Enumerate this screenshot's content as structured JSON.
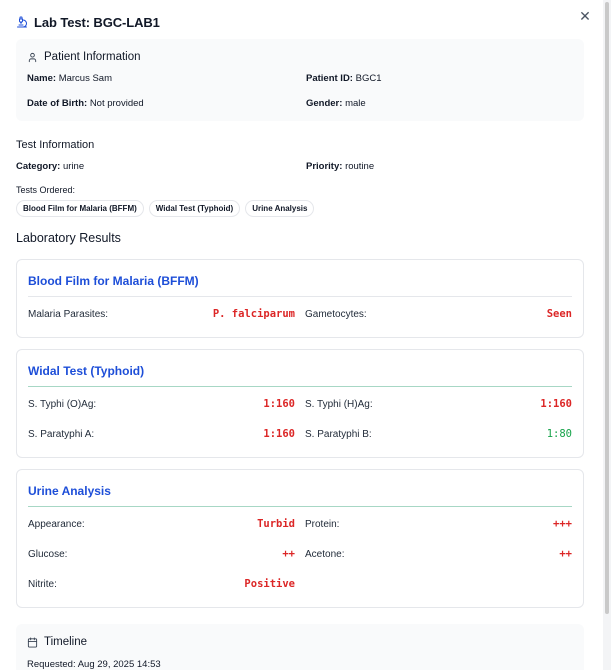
{
  "header": {
    "title": "Lab Test: BGC-LAB1",
    "icon": "microscope-icon",
    "close_icon": "close-icon"
  },
  "patient": {
    "section_title": "Patient Information",
    "name_label": "Name:",
    "name_value": "Marcus Sam",
    "id_label": "Patient ID:",
    "id_value": "BGC1",
    "dob_label": "Date of Birth:",
    "dob_value": "Not provided",
    "gender_label": "Gender:",
    "gender_value": "male"
  },
  "test_info": {
    "section_title": "Test Information",
    "category_label": "Category:",
    "category_value": "urine",
    "priority_label": "Priority:",
    "priority_value": "routine",
    "tests_ordered_label": "Tests Ordered:",
    "tests_ordered": [
      "Blood Film for Malaria (BFFM)",
      "Widal Test (Typhoid)",
      "Urine Analysis"
    ]
  },
  "results": {
    "title": "Laboratory Results",
    "bffm": {
      "title": "Blood Film for Malaria (BFFM)",
      "malaria_label": "Malaria Parasites:",
      "malaria_value": "P. falciparum",
      "gametocytes_label": "Gametocytes:",
      "gametocytes_value": "Seen"
    },
    "widal": {
      "title": "Widal Test (Typhoid)",
      "o_label": "S. Typhi (O)Ag:",
      "o_value": "1:160",
      "h_label": "S. Typhi (H)Ag:",
      "h_value": "1:160",
      "pa_label": "S. Paratyphi A:",
      "pa_value": "1:160",
      "pb_label": "S. Paratyphi B:",
      "pb_value": "1:80"
    },
    "urine": {
      "title": "Urine Analysis",
      "appearance_label": "Appearance:",
      "appearance_value": "Turbid",
      "protein_label": "Protein:",
      "protein_value": "+++",
      "glucose_label": "Glucose:",
      "glucose_value": "++",
      "acetone_label": "Acetone:",
      "acetone_value": "++",
      "nitrite_label": "Nitrite:",
      "nitrite_value": "Positive"
    }
  },
  "timeline": {
    "section_title": "Timeline",
    "requested_label": "Requested:",
    "requested_value": "Aug 29, 2025 14:53"
  },
  "colors": {
    "accent": "#1d4ed8",
    "abnormal": "#dc2626",
    "normal": "#16a34a",
    "divider": "#a7d7c5"
  }
}
